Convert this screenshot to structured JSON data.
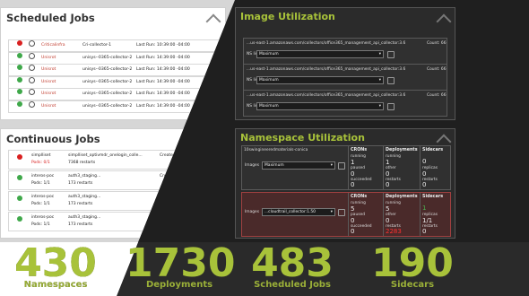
{
  "scheduled": {
    "title": "Scheduled Jobs",
    "rows": [
      {
        "status": "error",
        "name": "Criticalinfra",
        "job": "Cri-collector-1",
        "last": "Last Run: 10:39:00 -04:00"
      },
      {
        "status": "ok",
        "name": "Unisrot",
        "job": "unisys--0365-collector-2",
        "last": "Last Run: 14:39:00 -04:00"
      },
      {
        "status": "ok",
        "name": "Unisrot",
        "job": "unisys--0365-collector-2",
        "last": "Last Run: 14:39:00 -04:00"
      },
      {
        "status": "ok",
        "name": "Unisrot",
        "job": "unisys--0365-collector-2",
        "last": "Last Run: 14:39:00 -04:00"
      },
      {
        "status": "ok",
        "name": "Unisrot",
        "job": "unisys--0365-collector-2",
        "last": "Last Run: 14:39:00 -04:00"
      },
      {
        "status": "ok",
        "name": "Unisrot",
        "job": "unisys--0365-collector-2",
        "last": "Last Run: 14:39:00 -04:00"
      }
    ]
  },
  "continuous": {
    "title": "Continuous Jobs",
    "rows": [
      {
        "status": "error",
        "name": "simplliset",
        "pods": "Pods: 0/1",
        "job": "simplliset_optivmdr_onelogin_colle...",
        "restarts": "7368 restarts",
        "created": "Created: 10:39:00 -04:00"
      },
      {
        "status": "ok",
        "name": "interos-poc",
        "pods": "Pods: 1/1",
        "job": "auth3_staging...",
        "restarts": "173 restarts",
        "created": "Created: 14:39:00"
      },
      {
        "status": "ok",
        "name": "interos-poc",
        "pods": "Pods: 1/1",
        "job": "auth3_staging...",
        "restarts": "173 restarts",
        "created": "Created: 14:39:00"
      },
      {
        "status": "ok",
        "name": "interos-poc",
        "pods": "Pods: 1/1",
        "job": "auth3_staging...",
        "restarts": "173 restarts",
        "created": "Created: 14:39:00"
      }
    ]
  },
  "image": {
    "title": "Image Utilization",
    "rows": [
      {
        "path": "...us-east-1.amazonaws.com/collectors/office365_management_api_collector:3.6",
        "count": "Count: 66",
        "ns_label": "NS list",
        "select": "Maximum"
      },
      {
        "path": "...us-east-1.amazonaws.com/collectors/office365_management_api_collector:3.6",
        "count": "Count: 66",
        "ns_label": "NS list",
        "select": "Maximum"
      },
      {
        "path": "...us-east-1.amazonaws.com/collectors/office365_management_api_collector:3.6",
        "count": "Count: 66",
        "ns_label": "NS list",
        "select": "Maximum"
      }
    ]
  },
  "namespace": {
    "title": "Namespace Utilization",
    "rows": [
      {
        "name": "10swingineeredmaterials-conica",
        "images_label": "Images",
        "select": "Maximum",
        "crons_label": "CRONs",
        "crons_running": "running",
        "crons_running_val": "1",
        "crons_paused": "paused",
        "crons_paused_val": "0",
        "crons_succ": "succeeded",
        "crons_succ_val": "0",
        "dep_label": "Deployments",
        "dep_running": "running",
        "dep_running_val": "1",
        "dep_other": "other",
        "dep_other_val": "0",
        "dep_restarts": "restarts",
        "dep_restarts_val": "0",
        "side_label": "Sidecars",
        "side_val": "0",
        "side_replicas": "replicas",
        "side_replicas_val": "0",
        "side_restarts": "restarts",
        "side_restarts_val": "0"
      },
      {
        "name": "",
        "images_label": "Images",
        "select": "...cloudtrail_collector:1.50",
        "crons_label": "CRONs",
        "crons_running": "running",
        "crons_running_val": "5",
        "crons_paused": "paused",
        "crons_paused_val": "0",
        "crons_succ": "succeeded",
        "crons_succ_val": "0",
        "dep_label": "Deployments",
        "dep_running": "running",
        "dep_running_val": "5",
        "dep_other": "other",
        "dep_other_val": "0",
        "dep_restarts": "restarts",
        "dep_restarts_val": "2283",
        "side_label": "Sidecars",
        "side_val": "1",
        "side_replicas": "replicas",
        "side_replicas_val": "1/1",
        "side_restarts": "restarts",
        "side_restarts_val": "0"
      }
    ]
  },
  "stats": [
    {
      "value": "430",
      "label": "Namespaces"
    },
    {
      "value": "1730",
      "label": "Deployments"
    },
    {
      "value": "483",
      "label": "Scheduled Jobs"
    },
    {
      "value": "190",
      "label": "Sidecars"
    }
  ],
  "colors": {
    "accent": "#a8c23a",
    "ok": "#3fa84a",
    "error": "#d92020",
    "dark_bg": "#222222",
    "light_bg": "#ffffff"
  }
}
